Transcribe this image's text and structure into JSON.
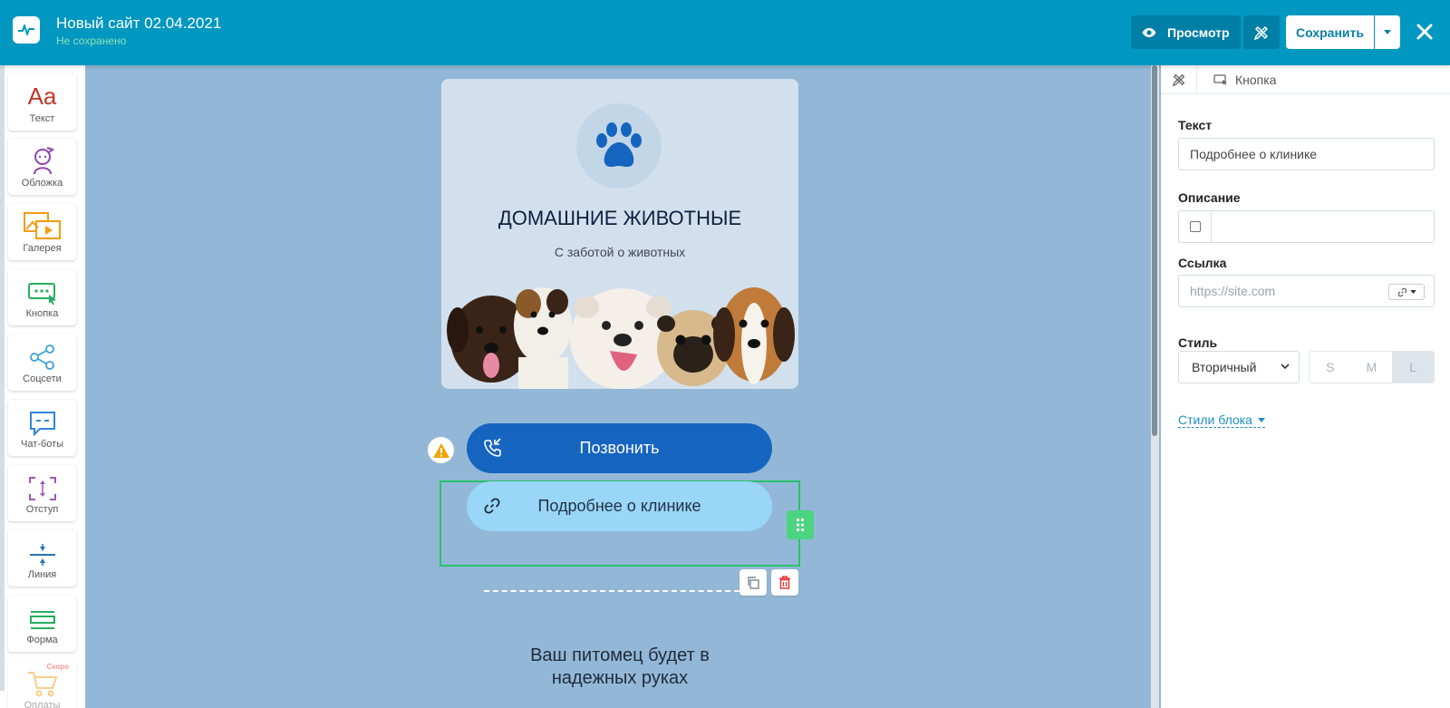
{
  "header": {
    "site_title": "Новый сайт 02.04.2021",
    "site_status": "Не сохранено",
    "preview_label": "Просмотр",
    "save_label": "Сохранить"
  },
  "toolbar": {
    "items": [
      {
        "label": "Текст",
        "icon": "text-aa-icon"
      },
      {
        "label": "Обложка",
        "icon": "cover-face-icon"
      },
      {
        "label": "Галерея",
        "icon": "gallery-icon"
      },
      {
        "label": "Кнопка",
        "icon": "button-cursor-icon"
      },
      {
        "label": "Соцсети",
        "icon": "share-icon"
      },
      {
        "label": "Чат-боты",
        "icon": "chat-icon"
      },
      {
        "label": "Отступ",
        "icon": "spacing-icon"
      },
      {
        "label": "Линия",
        "icon": "line-icon"
      },
      {
        "label": "Форма",
        "icon": "form-icon"
      },
      {
        "label": "Оплаты",
        "icon": "cart-icon",
        "badge": "Скоро"
      }
    ],
    "text_glyph": "Aa"
  },
  "canvas": {
    "card_title": "ДОМАШНИЕ ЖИВОТНЫЕ",
    "card_subtitle": "С заботой о животных",
    "call_button": "Позвонить",
    "more_button": "Подробнее о клинике",
    "tagline_line1": "Ваш питомец будет в",
    "tagline_line2": "надежных руках"
  },
  "panel": {
    "breadcrumb": "Кнопка",
    "text_label": "Текст",
    "text_value": "Подробнее о клинике",
    "description_label": "Описание",
    "link_label": "Ссылка",
    "link_placeholder": "https://site.com",
    "style_label": "Стиль",
    "style_value": "Вторичный",
    "sizes": [
      "S",
      "M",
      "L"
    ],
    "active_size": "L",
    "block_styles": "Стили блока"
  },
  "colors": {
    "header": "#0097c1",
    "canvas_bg": "#93b8d7",
    "primary_button": "#1565c0",
    "secondary_button": "#99d6f7",
    "selection": "#27c26a",
    "status_saved": "#8de2b6"
  }
}
